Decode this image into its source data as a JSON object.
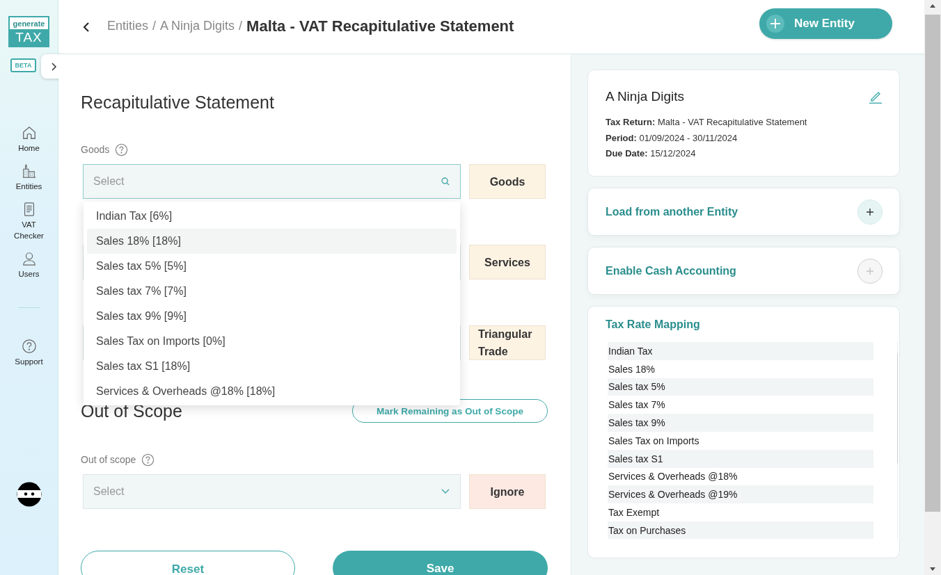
{
  "sidebar": {
    "logo": {
      "top": "generate",
      "bottom": "TAX"
    },
    "badge": "BETA",
    "nav": [
      {
        "label": "Home"
      },
      {
        "label": "Entities"
      },
      {
        "label": "VAT Checker"
      },
      {
        "label": "Users"
      }
    ],
    "footer_nav": [
      {
        "label": "Support"
      }
    ]
  },
  "header": {
    "breadcrumb": [
      {
        "label": "Entities",
        "kind": "link"
      },
      {
        "label": "/",
        "kind": "separator"
      },
      {
        "label": "A Ninja Digits",
        "kind": "link"
      },
      {
        "label": "/",
        "kind": "separator"
      },
      {
        "label": "Malta - VAT Recapitulative Statement",
        "kind": "current"
      }
    ],
    "new_entity_button": "New Entity"
  },
  "form": {
    "title": "Recapitulative Statement",
    "rows": [
      {
        "label": "Goods",
        "field": {
          "placeholder": "Select",
          "focused": true
        },
        "tag": {
          "label": "Goods",
          "color": "#fdf3e3"
        }
      },
      {
        "field": {
          "focused": false
        },
        "tag": {
          "label": "Services",
          "color": "#fdf3e3"
        }
      },
      {
        "field": {
          "focused": false
        },
        "tag": {
          "label": "Triangular Trade",
          "color": "#fdf3e3"
        }
      }
    ],
    "dropdown": [
      {
        "label": "Indian Tax [6%]",
        "selected": false
      },
      {
        "label": "Sales 18% [18%]",
        "selected": true
      },
      {
        "label": "Sales tax 5% [5%]",
        "selected": false
      },
      {
        "label": "Sales tax 7% [7%]",
        "selected": false
      },
      {
        "label": "Sales tax 9% [9%]",
        "selected": false
      },
      {
        "label": "Sales Tax on Imports [0%]",
        "selected": false
      },
      {
        "label": "Sales tax S1 [18%]",
        "selected": false
      },
      {
        "label": "Services & Overheads @18% [18%]",
        "selected": false
      }
    ],
    "out_of_scope": {
      "title": "Out of Scope",
      "mark_button": "Mark Remaining as Out of Scope",
      "rows": [
        {
          "label": "Out of scope",
          "field": {
            "placeholder": "Select",
            "focused": false
          },
          "tag": {
            "label": "Ignore",
            "color": "#fde8e2"
          }
        }
      ]
    },
    "buttons": [
      {
        "label": "Reset",
        "kind": "outline"
      },
      {
        "label": "Save",
        "kind": "primary"
      }
    ]
  },
  "panel": {
    "entity": {
      "name": "A Ninja Digits",
      "details": [
        "**Tax Return:** Malta - VAT Recapitulative Statement",
        "**Period:** 01/09/2024 - 30/11/2024",
        "**Due Date:** 15/12/2024"
      ]
    },
    "options": [
      {
        "label": "Load from another Entity",
        "disabled": false
      },
      {
        "label": "Enable Cash Accounting",
        "disabled": true
      }
    ],
    "mapping": {
      "title": "Tax Rate Mapping",
      "items": [
        "Indian Tax",
        "Sales 18%",
        "Sales tax 5%",
        "Sales tax 7%",
        "Sales tax 9%",
        "Sales Tax on Imports",
        "Sales tax S1",
        "Services & Overheads @18%",
        "Services & Overheads @19%",
        "Tax Exempt",
        "Tax on Purchases"
      ]
    }
  }
}
